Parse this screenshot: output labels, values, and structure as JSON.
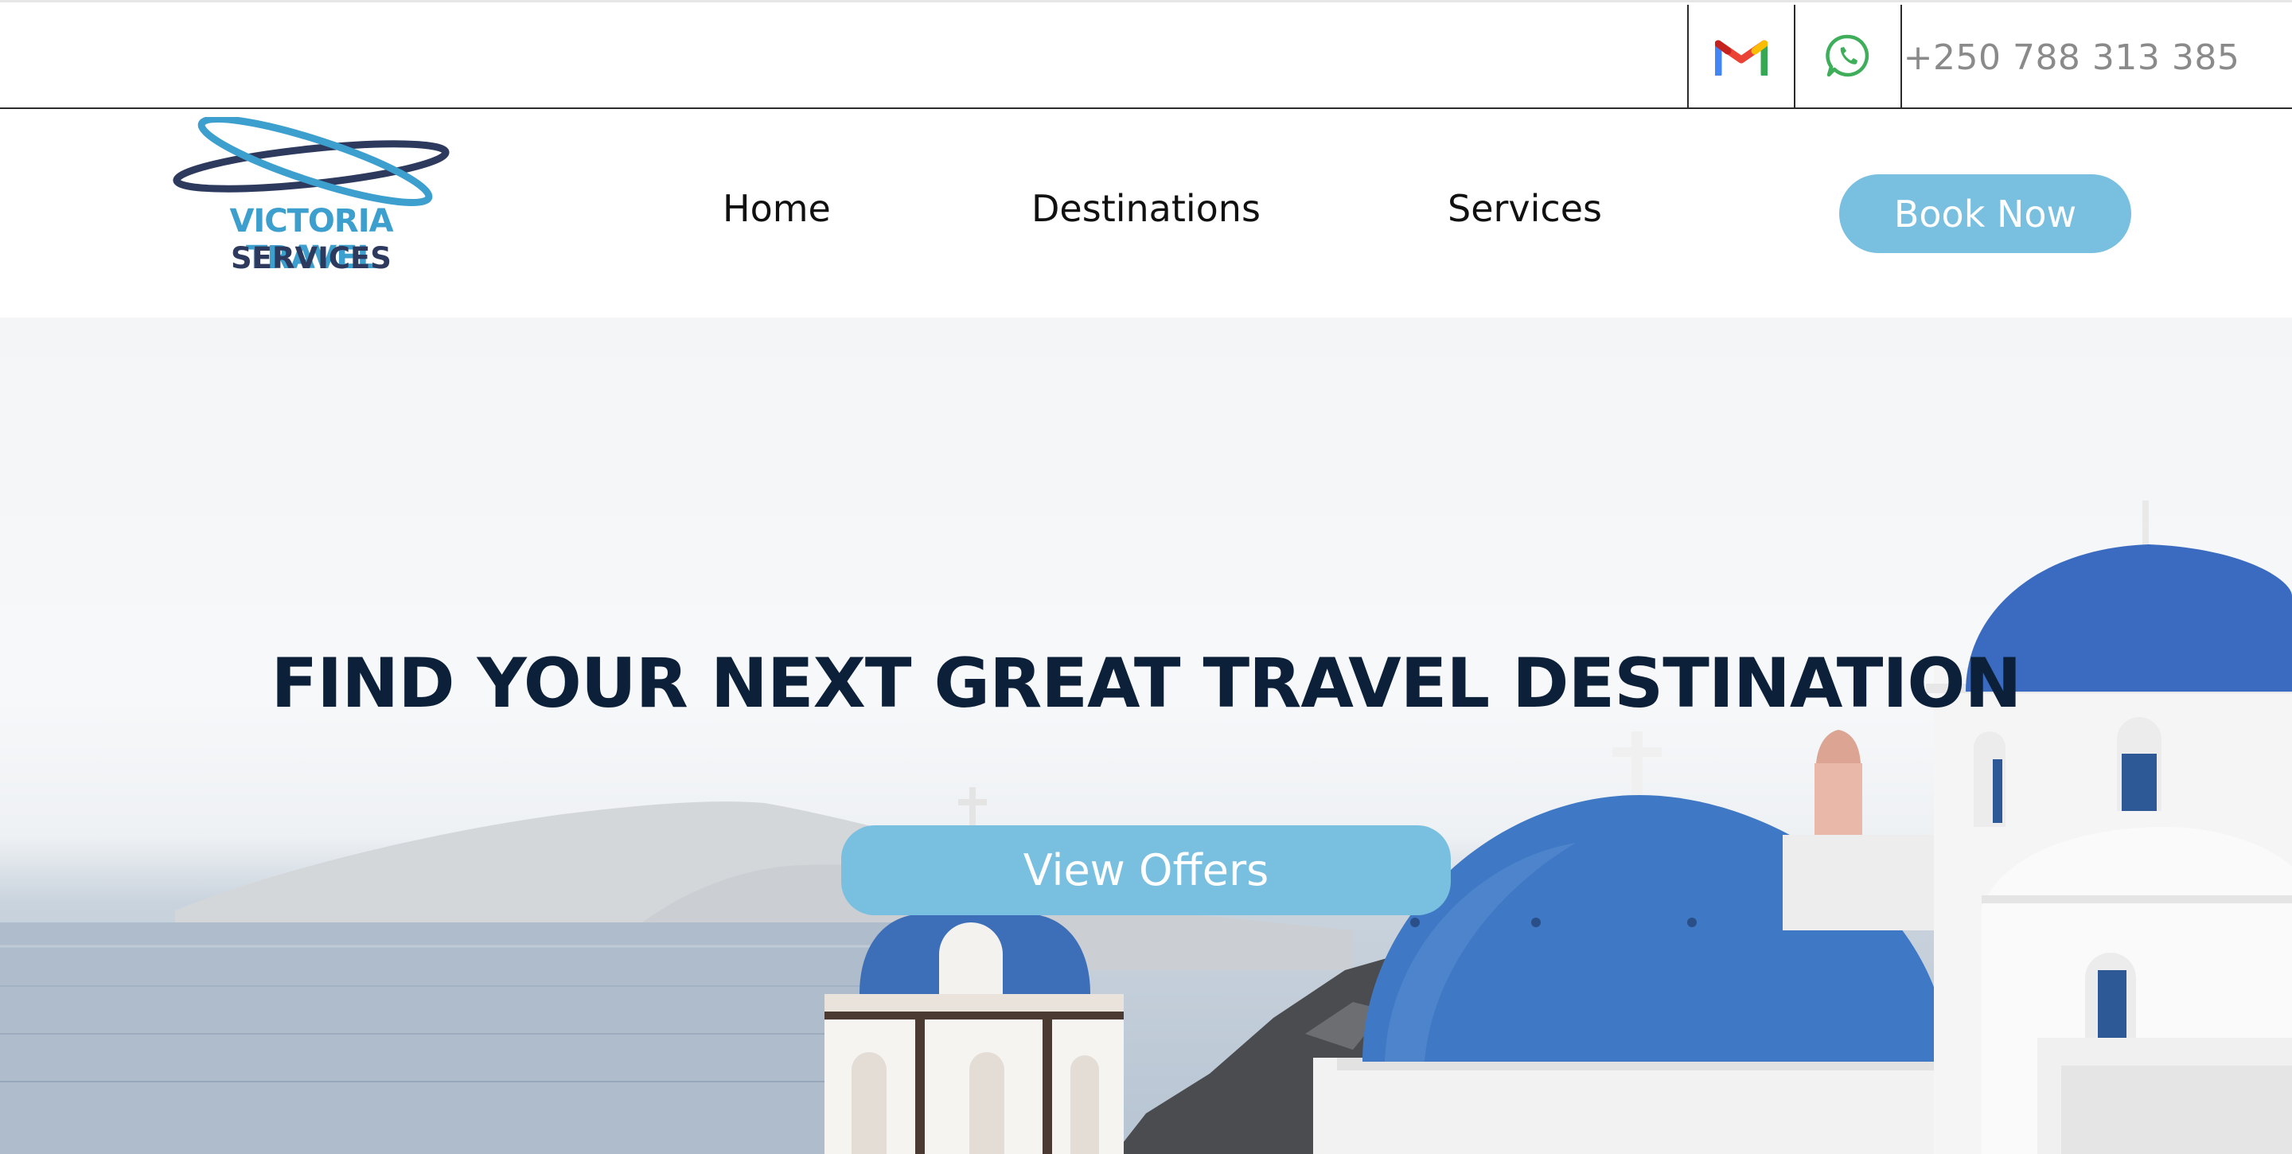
{
  "topbar": {
    "gmail_icon": "gmail-icon",
    "whatsapp_icon": "whatsapp-icon",
    "phone": "+250 788 313 385"
  },
  "header": {
    "logo": {
      "line1": "VICTORIA TRAVEL",
      "line2": "SERVICES",
      "icon": "airplane-orbit-logo"
    },
    "nav": [
      {
        "label": "Home"
      },
      {
        "label": "Destinations"
      },
      {
        "label": "Services"
      }
    ],
    "cta_label": "Book Now"
  },
  "hero": {
    "title": "FIND YOUR NEXT GREAT TRAVEL DESTINATION",
    "button_label": "View Offers",
    "image": "santorini-blue-domes-photo"
  },
  "colors": {
    "accent": "#78bfe0",
    "title": "#0c2139",
    "logo_blue": "#3c9fce",
    "logo_navy": "#2d3a5e",
    "dome_blue": "#3f78c4"
  }
}
